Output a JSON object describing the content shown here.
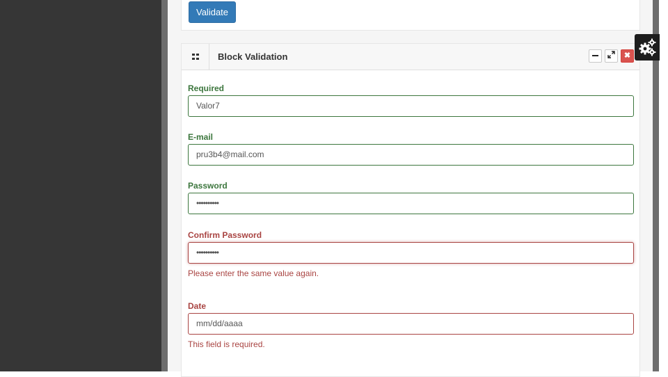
{
  "toolbar": {
    "validate_label": "Validate"
  },
  "panel": {
    "title": "Block Validation",
    "icon": "grid-icon",
    "controls": [
      "minimize-icon",
      "expand-icon",
      "close-icon"
    ]
  },
  "fields": {
    "required": {
      "label": "Required",
      "value": "Valor7",
      "state": "valid"
    },
    "email": {
      "label": "E-mail",
      "value": "pru3b4@mail.com",
      "state": "valid"
    },
    "password": {
      "label": "Password",
      "value": "••••••••••",
      "state": "valid"
    },
    "confirm_password": {
      "label": "Confirm Password",
      "value": "••••••••••",
      "state": "error",
      "error": "Please enter the same value again."
    },
    "date": {
      "label": "Date",
      "value": "mm/dd/aaaa",
      "state": "error",
      "error": "This field is required."
    }
  },
  "settings": {
    "icon": "gears-icon"
  },
  "colors": {
    "valid": "#3c763d",
    "error": "#a94442",
    "primary": "#337ab7",
    "sidebar": "#363636"
  }
}
